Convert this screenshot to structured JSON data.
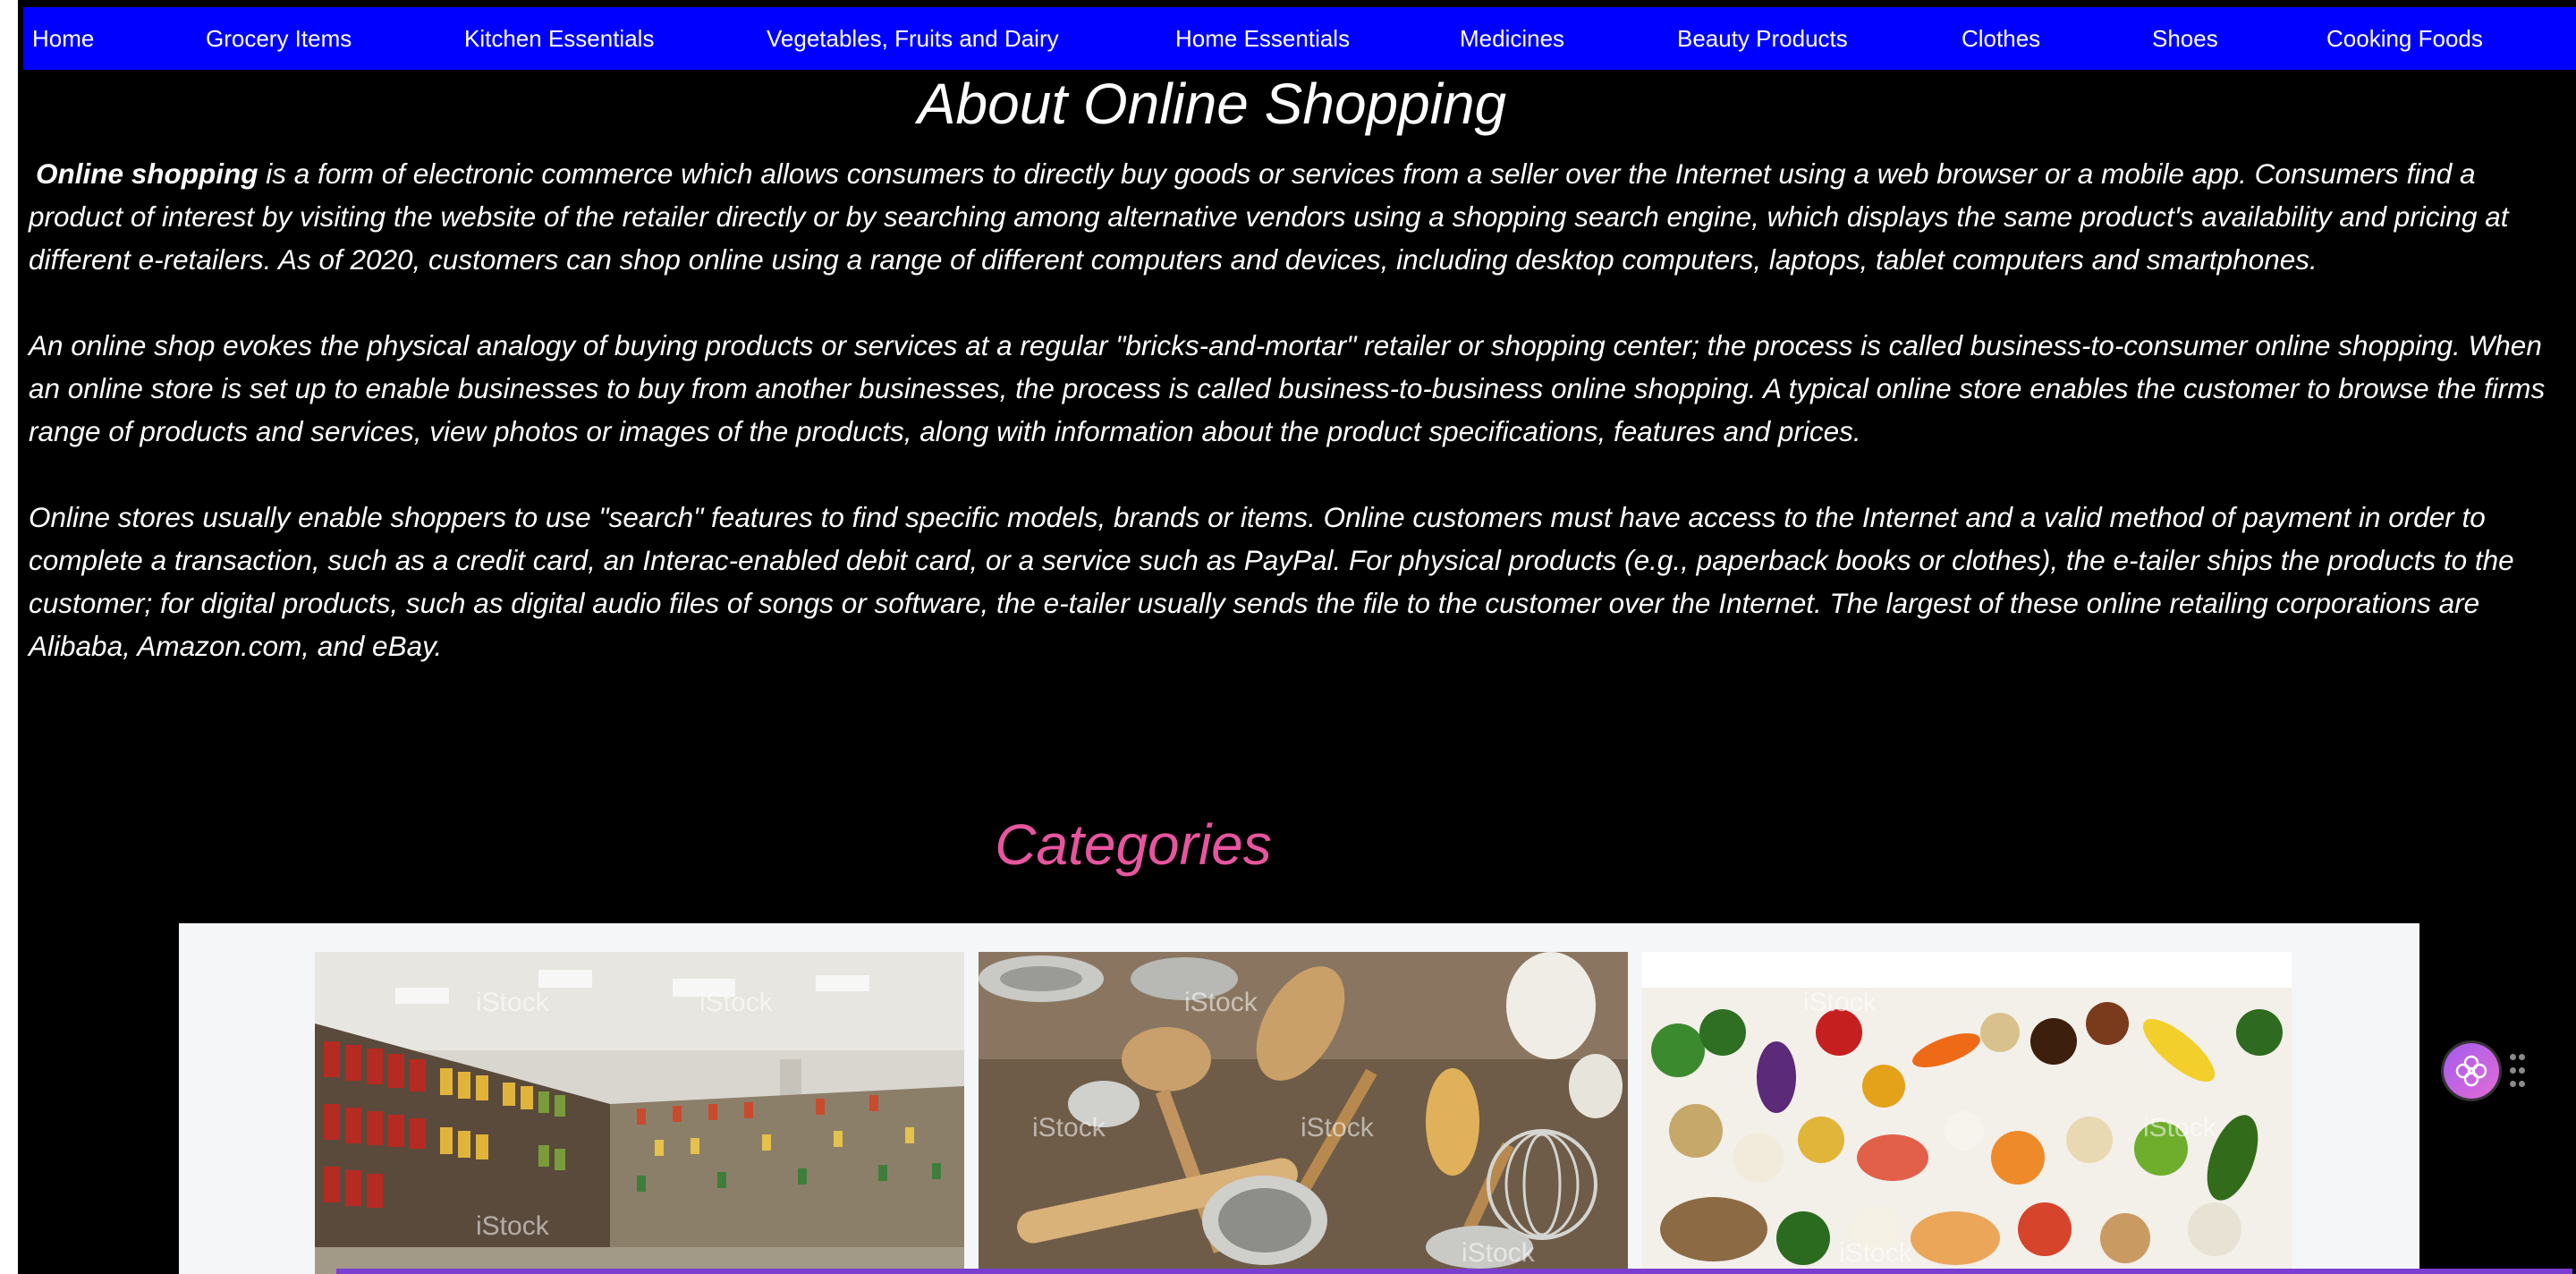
{
  "nav": {
    "items": [
      {
        "label": "Home"
      },
      {
        "label": "Grocery Items"
      },
      {
        "label": "Kitchen Essentials"
      },
      {
        "label": "Vegetables, Fruits and Dairy"
      },
      {
        "label": "Home Essentials"
      },
      {
        "label": "Medicines"
      },
      {
        "label": "Beauty Products"
      },
      {
        "label": "Clothes"
      },
      {
        "label": "Shoes"
      },
      {
        "label": "Cooking Foods"
      }
    ],
    "background": "#0000ff",
    "text_color": "#ffffff"
  },
  "about": {
    "title": "About Online Shopping",
    "para1_bold": "Online shopping",
    "para1_rest": " is a form of electronic commerce which allows consumers to directly buy goods or services from a seller over the Internet using a web browser or a mobile app. Consumers find a product of interest by visiting the website of the retailer directly or by searching among alternative vendors using a shopping search engine, which displays the same product's availability and pricing at different e-retailers. As of 2020, customers can shop online using a range of different computers and devices, including desktop computers, laptops, tablet computers and smartphones.",
    "para2": "An online shop evokes the physical analogy of buying products or services at a regular \"bricks-and-mortar\" retailer or shopping center; the process is called business-to-consumer online shopping. When an online store is set up to enable businesses to buy from another businesses, the process is called business-to-business online shopping. A typical online store enables the customer to browse the firms range of products and services, view photos or images of the products, along with information about the product specifications, features and prices.",
    "para3": "Online stores usually enable shoppers to use \"search\" features to find specific models, brands or items. Online customers must have access to the Internet and a valid method of payment in order to complete a transaction, such as a credit card, an Interac-enabled debit card, or a service such as PayPal. For physical products (e.g., paperback books or clothes), the e-tailer ships the products to the customer; for digital products, such as digital audio files of songs or software, the e-tailer usually sends the file to the customer over the Internet. The largest of these online retailing corporations are Alibaba, Amazon.com, and eBay."
  },
  "categories": {
    "title": "Categories",
    "title_color": "#e6559f",
    "cards": [
      {
        "image": "grocery-aisle-photo",
        "watermark": "iStock"
      },
      {
        "image": "kitchen-utensils-photo",
        "watermark": "iStock"
      },
      {
        "image": "vegetables-fruits-dairy-photo",
        "watermark": "iStock"
      }
    ]
  },
  "icons": {
    "assistant": "flower-assistant-icon",
    "drag": "drag-handle-icon"
  }
}
